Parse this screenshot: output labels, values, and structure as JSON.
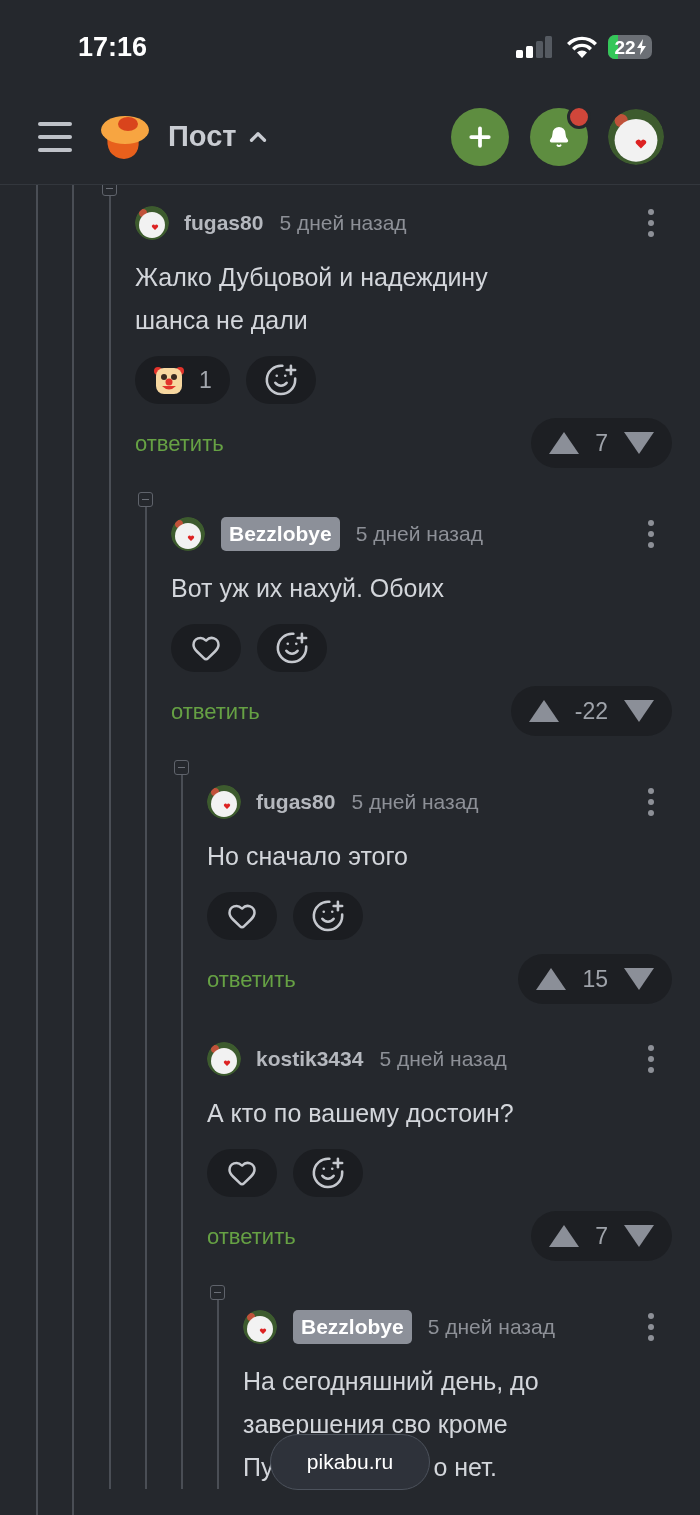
{
  "status_bar": {
    "time": "17:16",
    "battery": "22"
  },
  "header": {
    "title": "Пост",
    "notification_dot": true
  },
  "comments": [
    {
      "author": "fugas80",
      "author_badge": false,
      "time": "5 дней назад",
      "text": "Жалко Дубцовой и надеждину шанса не дали",
      "collapsible": true,
      "reactions": [
        {
          "kind": "clown",
          "count": "1"
        },
        {
          "kind": "add"
        }
      ],
      "reply_label": "ответить",
      "score": "7",
      "children": [
        {
          "author": "Bezzlobye",
          "author_badge": true,
          "time": "5 дней назад",
          "text": "Вот уж их нахуй. Обоих",
          "collapsible": true,
          "reactions": [
            {
              "kind": "like"
            },
            {
              "kind": "add"
            }
          ],
          "reply_label": "ответить",
          "score": "-22",
          "children": [
            {
              "author": "fugas80",
              "author_badge": false,
              "time": "5 дней назад",
              "text": "Но сначало этого",
              "collapsible": true,
              "reactions": [
                {
                  "kind": "like"
                },
                {
                  "kind": "add"
                }
              ],
              "reply_label": "ответить",
              "score": "15"
            },
            {
              "author": "kostik3434",
              "author_badge": false,
              "time": "5 дней назад",
              "text": "А кто по вашему достоин?",
              "collapsible": false,
              "reactions": [
                {
                  "kind": "like"
                },
                {
                  "kind": "add"
                }
              ],
              "reply_label": "ответить",
              "score": "7",
              "children": [
                {
                  "author": "Bezzlobye",
                  "author_badge": true,
                  "time": "5 дней назад",
                  "text": "На сегодняшний день, до завершения сво кроме",
                  "text_split_line": [
                    "Пу",
                    "о нет."
                  ],
                  "collapsible": true
                }
              ]
            }
          ]
        }
      ]
    }
  ],
  "browser_bar": {
    "url": "pikabu.ru"
  }
}
